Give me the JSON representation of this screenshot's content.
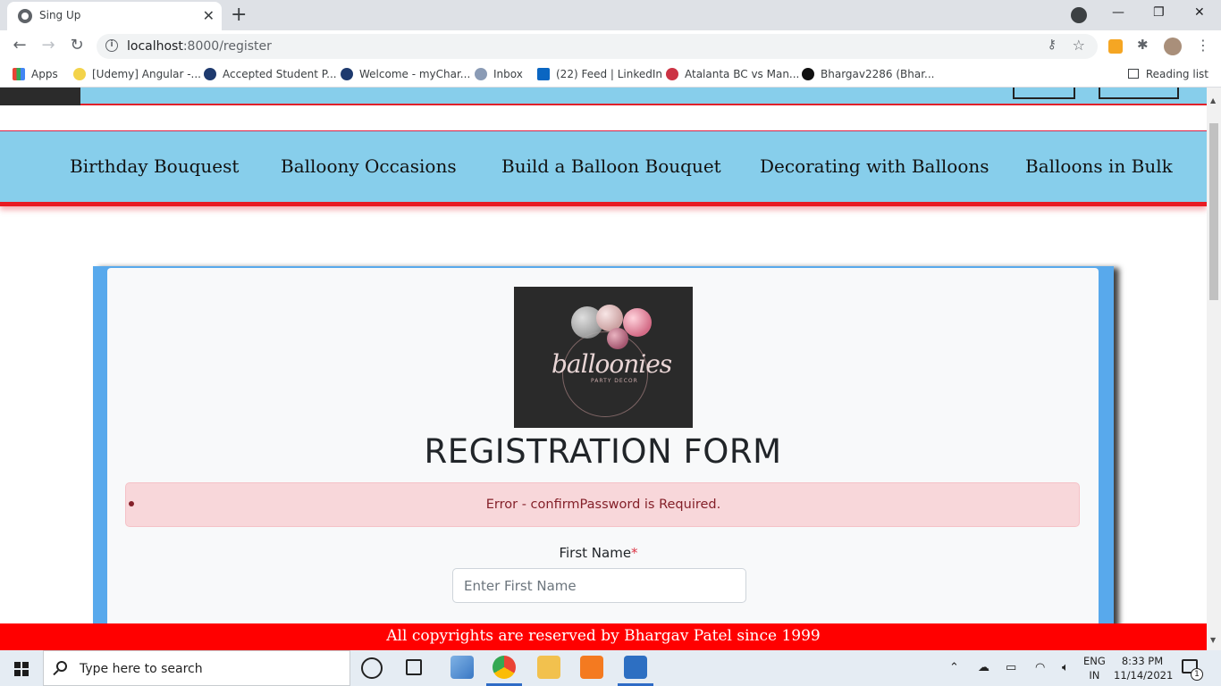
{
  "browser": {
    "tab_title": "Sing Up",
    "url_host": "localhost",
    "url_rest": ":8000/register",
    "bookmarks": [
      {
        "label": "Apps"
      },
      {
        "label": "[Udemy] Angular -..."
      },
      {
        "label": "Accepted Student P..."
      },
      {
        "label": "Welcome - myChar..."
      },
      {
        "label": "Inbox"
      },
      {
        "label": "(22) Feed | LinkedIn"
      },
      {
        "label": "Atalanta BC vs Man..."
      },
      {
        "label": "Bhargav2286 (Bhar..."
      }
    ],
    "reading_list": "Reading list"
  },
  "nav": {
    "items": [
      {
        "label": "Birthday Bouquest"
      },
      {
        "label": "Balloony Occasions"
      },
      {
        "label": "Build a Balloon Bouquet"
      },
      {
        "label": "Decorating with Balloons"
      },
      {
        "label": "Balloons in Bulk"
      }
    ]
  },
  "logo": {
    "text": "balloonies",
    "subtext": "PARTY DECOR"
  },
  "form": {
    "title": "REGISTRATION FORM",
    "error": "Error - confirmPassword is Required.",
    "first_name_label": "First Name",
    "required_mark": "*",
    "first_name_placeholder": "Enter First Name"
  },
  "footer": {
    "text": "All copyrights are reserved by Bhargav Patel since 1999"
  },
  "taskbar": {
    "search_placeholder": "Type here to search",
    "lang_top": "ENG",
    "lang_bottom": "IN",
    "time": "8:33 PM",
    "date": "11/14/2021",
    "notification_count": "1"
  },
  "colors": {
    "nav_bg": "#87ceeb",
    "nav_shadow": "#e81a22",
    "card_accent": "#58a9ec",
    "alert_bg": "#f8d7da",
    "alert_text": "#842029",
    "footer_bg": "#ff0000"
  }
}
